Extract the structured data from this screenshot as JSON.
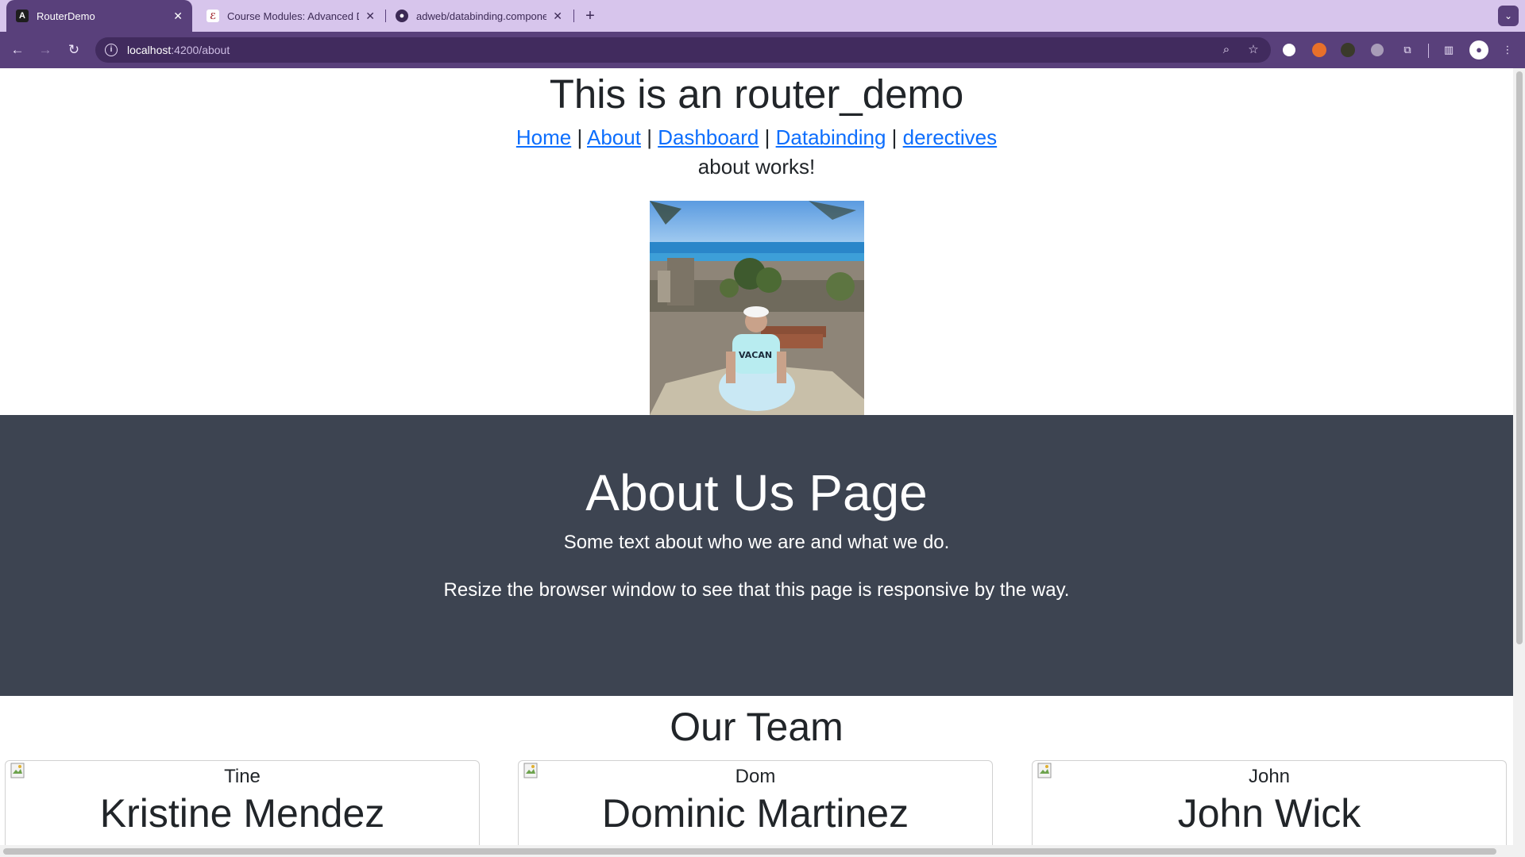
{
  "browser": {
    "tabs": [
      {
        "title": "RouterDemo",
        "active": true,
        "favicon": "angular-icon"
      },
      {
        "title": "Course Modules: Advanced D",
        "active": false,
        "favicon": "course-icon"
      },
      {
        "title": "adweb/databinding.compone",
        "active": false,
        "favicon": "github-icon"
      }
    ],
    "url_host": "localhost",
    "url_path": ":4200/about",
    "colors": {
      "frame": "#d7c5ec",
      "toolbar": "#59407b",
      "omnibox": "#412b5e"
    }
  },
  "page": {
    "title": "This is an router_demo",
    "nav": [
      {
        "label": "Home"
      },
      {
        "label": "About"
      },
      {
        "label": "Dashboard"
      },
      {
        "label": "Databinding"
      },
      {
        "label": "derectives"
      }
    ],
    "nav_separator": "|",
    "about_works": "about works!",
    "hero": {
      "heading": "About Us Page",
      "line1": "Some text about who we are and what we do.",
      "line2": "Resize the browser window to see that this page is responsive by the way.",
      "bg_color": "#3d4451"
    },
    "team_heading": "Our Team",
    "team": [
      {
        "alt": "Tine",
        "name": "Kristine Mendez"
      },
      {
        "alt": "Dom",
        "name": "Dominic Martinez"
      },
      {
        "alt": "John",
        "name": "John Wick"
      }
    ],
    "link_color": "#0d6efd"
  }
}
